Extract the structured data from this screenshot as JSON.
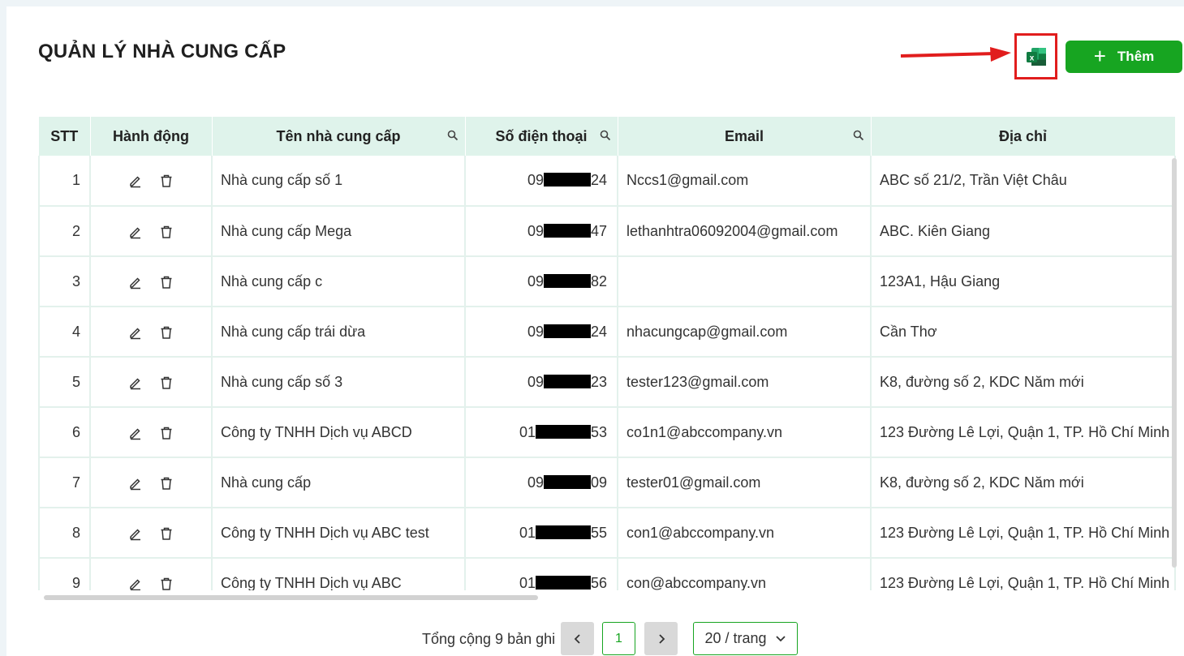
{
  "page": {
    "title": "QUẢN LÝ NHÀ CUNG CẤP"
  },
  "toolbar": {
    "excel_icon": "excel-icon",
    "add_label": "Thêm",
    "add_icon": "plus-icon"
  },
  "colors": {
    "accent": "#17a521",
    "header_bg": "#dff3eb",
    "highlight": "#e11d1d"
  },
  "table": {
    "columns": [
      "STT",
      "Hành động",
      "Tên nhà cung cấp",
      "Số điện thoại",
      "Email",
      "Địa chỉ"
    ],
    "rows": [
      {
        "stt": "1",
        "name": "Nhà cung cấp số 1",
        "phone_start": "09",
        "phone_end": "24",
        "email": "Nccs1@gmail.com",
        "address": "ABC số 21/2, Trần Việt Châu"
      },
      {
        "stt": "2",
        "name": "Nhà cung cấp Mega",
        "phone_start": "09",
        "phone_end": "47",
        "email": "lethanhtra06092004@gmail.com",
        "address": "ABC. Kiên Giang"
      },
      {
        "stt": "3",
        "name": "Nhà cung cấp c",
        "phone_start": "09",
        "phone_end": "82",
        "email": "",
        "address": "123A1, Hậu Giang"
      },
      {
        "stt": "4",
        "name": "Nhà cung cấp trái dừa",
        "phone_start": "09",
        "phone_end": "24",
        "email": "nhacungcap@gmail.com",
        "address": "Cần Thơ"
      },
      {
        "stt": "5",
        "name": "Nhà cung cấp số 3",
        "phone_start": "09",
        "phone_end": "23",
        "email": "tester123@gmail.com",
        "address": "K8, đường số 2, KDC Năm mới"
      },
      {
        "stt": "6",
        "name": "Công ty TNHH Dịch vụ ABCD",
        "phone_start": "01",
        "phone_end": "53",
        "email": "co1n1@abccompany.vn",
        "address": "123 Đường Lê Lợi, Quận 1, TP. Hồ Chí Minh"
      },
      {
        "stt": "7",
        "name": "Nhà cung cấp",
        "phone_start": "09",
        "phone_end": "09",
        "email": "tester01@gmail.com",
        "address": "K8, đường số 2, KDC Năm mới"
      },
      {
        "stt": "8",
        "name": "Công ty TNHH Dịch vụ ABC test",
        "phone_start": "01",
        "phone_end": "55",
        "email": "con1@abccompany.vn",
        "address": "123 Đường Lê Lợi, Quận 1, TP. Hồ Chí Minh"
      },
      {
        "stt": "9",
        "name": "Công ty TNHH Dịch vụ ABC",
        "phone_start": "01",
        "phone_end": "56",
        "email": "con@abccompany.vn",
        "address": "123 Đường Lê Lợi, Quận 1, TP. Hồ Chí Minh"
      }
    ]
  },
  "pagination": {
    "total": "Tổng cộng 9 bản ghi",
    "prev": "<",
    "current": "1",
    "next": ">",
    "page_size": "20 / trang"
  }
}
